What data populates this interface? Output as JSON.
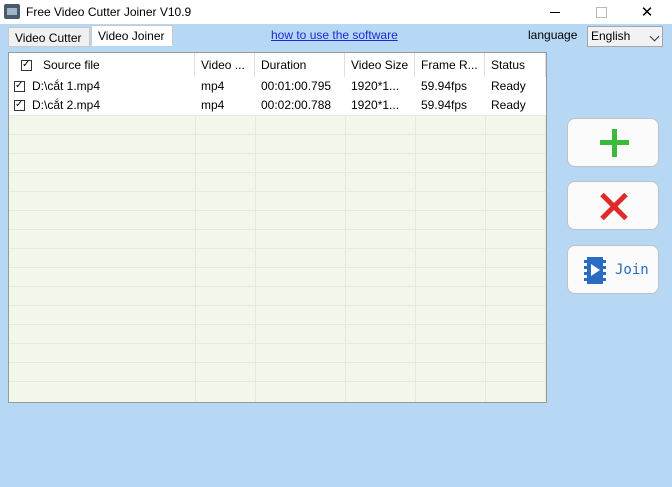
{
  "window": {
    "title": "Free Video Cutter Joiner V10.9"
  },
  "tabs": [
    {
      "label": "Video Cutter"
    },
    {
      "label": "Video Joiner"
    }
  ],
  "help_link": "how to use the software",
  "language": {
    "label": "language",
    "selected": "English"
  },
  "table": {
    "header_checked": true,
    "columns": [
      "Source file",
      "Video ...",
      "Duration",
      "Video Size",
      "Frame R...",
      "Status"
    ],
    "rows": [
      {
        "checked": true,
        "source": "D:\\cắt 1.mp4",
        "format": "mp4",
        "duration": "00:01:00.795",
        "size": "1920*1...",
        "frame_rate": "59.94fps",
        "status": "Ready"
      },
      {
        "checked": true,
        "source": "D:\\cắt 2.mp4",
        "format": "mp4",
        "duration": "00:02:00.788",
        "size": "1920*1...",
        "frame_rate": "59.94fps",
        "status": "Ready"
      }
    ]
  },
  "buttons": {
    "add_icon": "plus-icon",
    "delete_icon": "red-x-icon",
    "join_icon": "film-play-icon",
    "join_label": "Join"
  },
  "colors": {
    "background": "#b7d8f5",
    "link": "#1a2bd6",
    "add": "#3cb83c",
    "delete": "#e02a2a",
    "join": "#2a6cc2"
  }
}
